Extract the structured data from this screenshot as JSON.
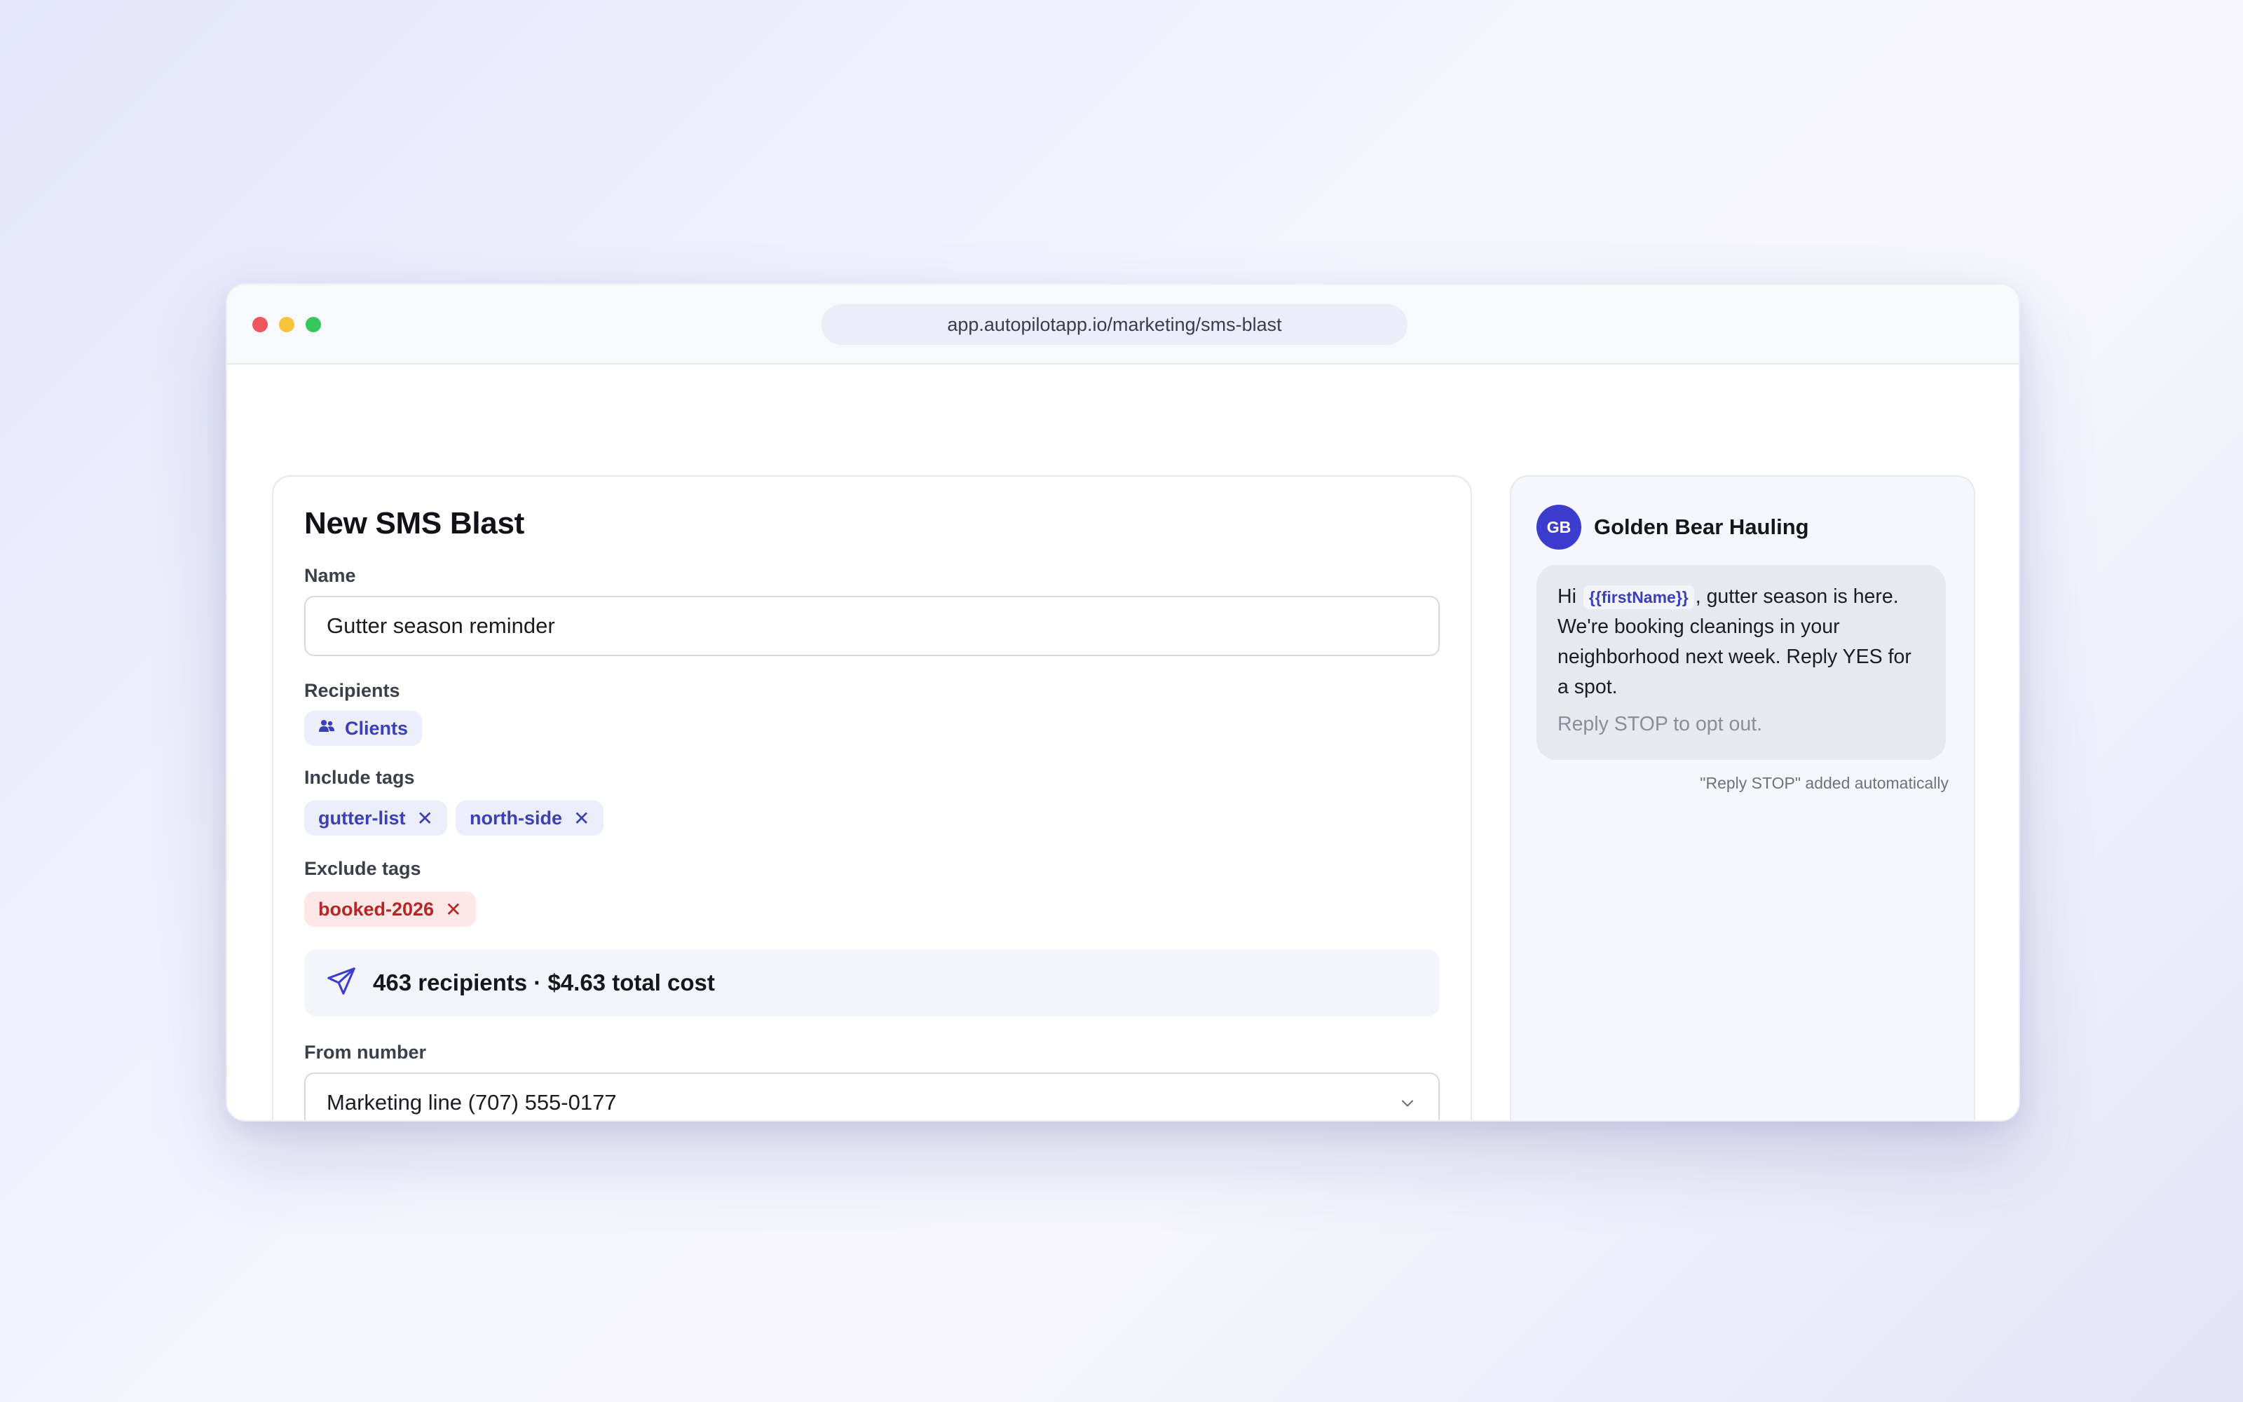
{
  "browser": {
    "url": "app.autopilotapp.io/marketing/sms-blast"
  },
  "form": {
    "title": "New SMS Blast",
    "name_label": "Name",
    "name_value": "Gutter season reminder",
    "recipients_label": "Recipients",
    "recipients": [
      {
        "label": "Clients",
        "icon": "users-icon"
      }
    ],
    "include_tags_label": "Include tags",
    "include_tags": [
      "gutter-list",
      "north-side"
    ],
    "exclude_tags_label": "Exclude tags",
    "exclude_tags": [
      "booked-2026"
    ],
    "summary_icon": "send-icon",
    "summary_text": "463 recipients · $4.63 total cost",
    "from_label": "From number",
    "from_value": "Marketing line (707) 555-0177"
  },
  "preview": {
    "avatar_initials": "GB",
    "business_name": "Golden Bear Hauling",
    "message_before": "Hi",
    "message_variable": "{{firstName}}",
    "message_after": ", gutter season is here. We're booking cleanings in your neighborhood next week. Reply YES for a spot.",
    "opt_out": "Reply STOP to opt out.",
    "note": "\"Reply STOP\" added automatically"
  },
  "colors": {
    "accent": "#3c3ccf",
    "tag_blue_bg": "#eceefc",
    "tag_blue_text": "#3b3fb8",
    "tag_red_bg": "#fde7e7",
    "tag_red_text": "#b42727",
    "window_close": "#f0565f",
    "window_minimize": "#f7c23c",
    "window_maximize": "#37c65b"
  }
}
